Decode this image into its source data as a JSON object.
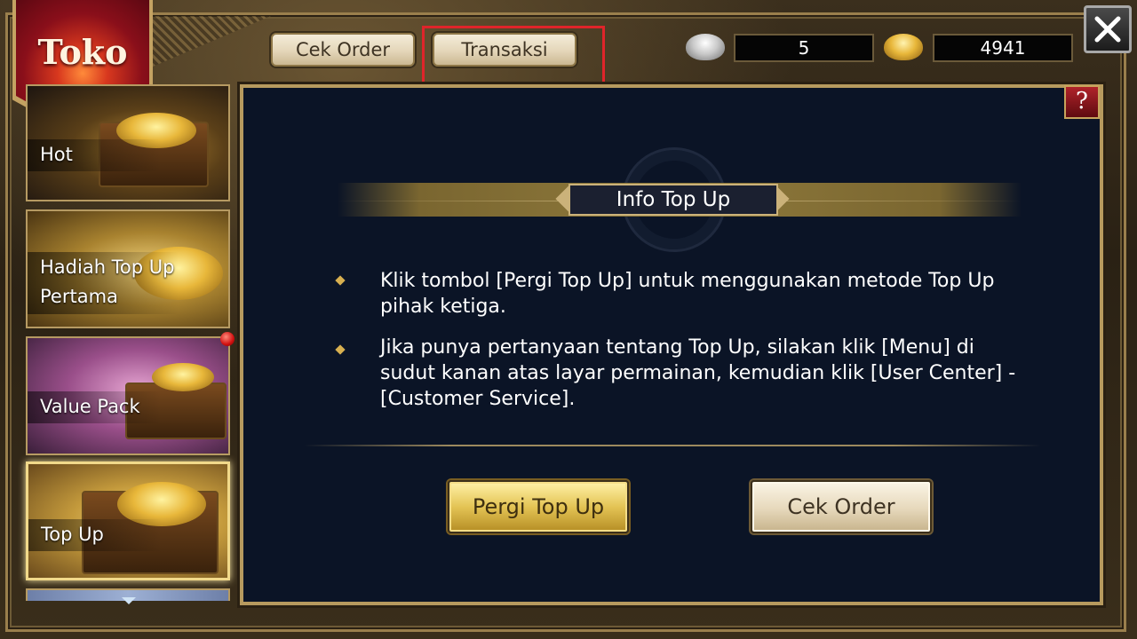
{
  "header": {
    "shop_title": "Toko",
    "tabs": [
      {
        "label": "Cek Order"
      },
      {
        "label": "Transaksi"
      }
    ]
  },
  "currency": {
    "silver": {
      "icon": "silver-ingot-icon",
      "amount": "5"
    },
    "gold": {
      "icon": "gold-ingot-icon",
      "amount": "4941"
    }
  },
  "close_icon": "close-icon",
  "help_label": "?",
  "sidebar": {
    "items": [
      {
        "label": "Hot"
      },
      {
        "label": "Hadiah Top Up",
        "label2": "Pertama"
      },
      {
        "label": "Value Pack"
      },
      {
        "label": "Top Up",
        "selected": true
      }
    ]
  },
  "content": {
    "title": "Info Top Up",
    "bullets": [
      {
        "line1": "Klik tombol [Pergi Top Up] untuk menggunakan metode Top Up",
        "line2": "pihak ketiga."
      },
      {
        "line1": "Jika punya pertanyaan tentang Top Up, silakan klik [Menu] di",
        "line2": "sudut kanan atas layar permainan, kemudian klik [User Center] -",
        "line3": "[Customer Service]."
      }
    ],
    "buttons": {
      "go_topup": "Pergi Top Up",
      "check_order": "Cek Order"
    }
  },
  "colors": {
    "panel_bg": "#0b1426",
    "gold_accent": "#b79a5e",
    "highlight": "#e0242a"
  }
}
